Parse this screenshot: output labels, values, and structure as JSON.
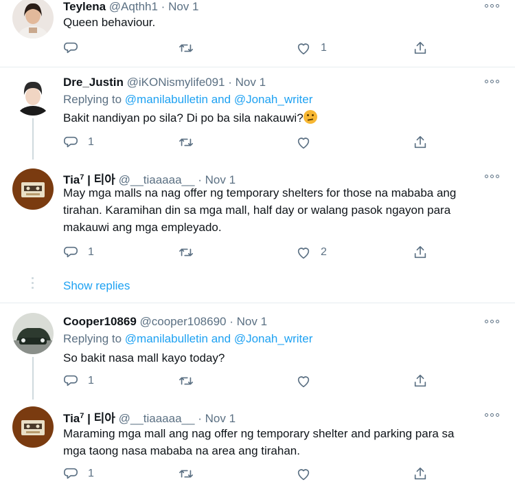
{
  "tweets": [
    {
      "name": "Teylena",
      "handle": "@Aqthh1",
      "sep": "·",
      "date": "Nov 1",
      "replying_prefix": "",
      "replying_links": "",
      "text": "Queen behaviour.",
      "reply_count": "",
      "retweet_count": "",
      "like_count": "1"
    },
    {
      "name": "Dre_Justin",
      "handle": "@iKONismylife091",
      "sep": "·",
      "date": "Nov 1",
      "replying_prefix": "Replying to",
      "replying_links": "@manilabulletin and @Jonah_writer",
      "text": "Bakit nandiyan po sila? Di po ba sila nakauwi?",
      "emoji": "thinking-face",
      "reply_count": "1",
      "retweet_count": "",
      "like_count": ""
    },
    {
      "name": "Tia",
      "name_sup": "7",
      "name_suffix": " | 티아",
      "handle": "@__tiaaaaa__",
      "sep": "·",
      "date": "Nov 1",
      "text_lines": [
        "May mga malls na nag offer ng temporary shelters for those na mababa ang",
        "tirahan. Karamihan din sa mga mall, half day or walang pasok ngayon para",
        "makauwi ang mga empleyado."
      ],
      "reply_count": "1",
      "retweet_count": "",
      "like_count": "2"
    },
    {
      "name": "Cooper10869",
      "handle": "@cooper108690",
      "sep": "·",
      "date": "Nov 1",
      "replying_prefix": "Replying to",
      "replying_links": "@manilabulletin and @Jonah_writer",
      "text": "So bakit nasa mall kayo today?",
      "reply_count": "1",
      "retweet_count": "",
      "like_count": ""
    },
    {
      "name": "Tia",
      "name_sup": "7",
      "name_suffix": " | 티아",
      "handle": "@__tiaaaaa__",
      "sep": "·",
      "date": "Nov 1",
      "text_lines": [
        "Maraming mga mall ang nag offer ng temporary shelter and parking para sa",
        "mga taong nasa mababa na area ang tirahan."
      ],
      "reply_count": "1",
      "retweet_count": "",
      "like_count": ""
    }
  ],
  "show_replies": "Show replies",
  "colors": {
    "accent": "#1da1f2",
    "muted": "#5b7083",
    "text": "#0f1419",
    "divider": "#e6ecf0"
  },
  "icons": [
    "reply-icon",
    "retweet-icon",
    "like-icon",
    "share-icon",
    "more-icon"
  ]
}
